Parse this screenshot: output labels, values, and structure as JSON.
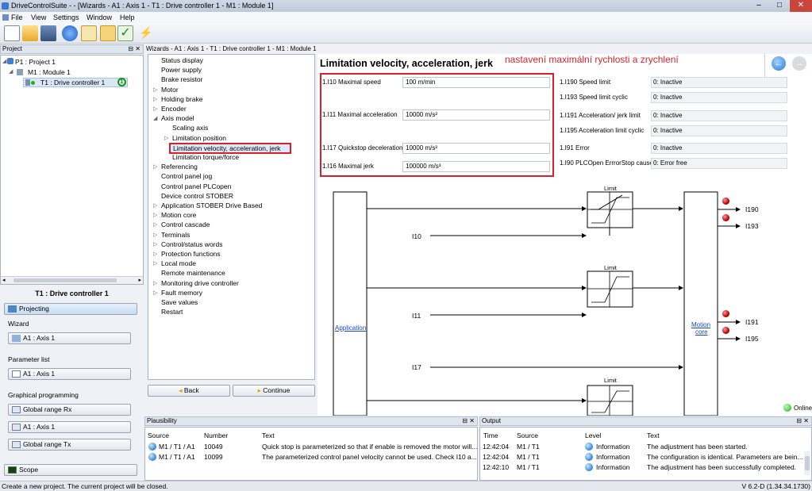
{
  "window": {
    "title": "DriveControlSuite - - [Wizards - A1 : Axis 1 - T1 : Drive controller 1 - M1 : Module 1]",
    "minimize": "–",
    "maximize": "□",
    "close": "✕"
  },
  "menu": [
    "File",
    "View",
    "Settings",
    "Window",
    "Help"
  ],
  "project_panel": {
    "title": "Project",
    "pin": "⊟ ✕",
    "tree": [
      "P1 : Project 1",
      "M1 : Module 1",
      "T1 : Drive controller 1"
    ]
  },
  "drive_panel": {
    "title": "T1 : Drive controller 1",
    "projecting": "Projecting",
    "wizard_label": "Wizard",
    "wizard_btn": "A1 : Axis 1",
    "param_label": "Parameter list",
    "param_btn": "A1 : Axis 1",
    "graph_label": "Graphical programming",
    "graph_btns": [
      "Global range Rx",
      "A1 : Axis 1",
      "Global range Tx"
    ],
    "scope": "Scope"
  },
  "wizard_breadcrumb": "Wizards - A1 : Axis 1 - T1 : Drive controller 1 - M1 : Module 1",
  "wizard_list": [
    "Status display",
    "Power supply",
    "Brake resistor",
    "Motor",
    "Holding brake",
    "Encoder",
    "Axis model",
    "Scaling axis",
    "Limitation position",
    "Limitation velocity, acceleration, jerk",
    "Limitation torque/force",
    "Referencing",
    "Control panel jog",
    "Control panel PLCopen",
    "Device control STOBER",
    "Application STOBER Drive Based",
    "Motion core",
    "Control cascade",
    "Terminals",
    "Control/status words",
    "Protection functions",
    "Local mode",
    "Remote maintenance",
    "Monitoring drive controller",
    "Fault memory",
    "Save values",
    "Restart"
  ],
  "back_btn": "Back",
  "continue_btn": "Continue",
  "content": {
    "heading": "Limitation velocity, acceleration, jerk",
    "annotation": "nastavení maximální rychlosti a zrychlení",
    "params": [
      {
        "label": "1.I10 Maximal speed",
        "value": "100 m/min"
      },
      {
        "label": "1.I11 Maximal acceleration",
        "value": "10000 m/s²"
      },
      {
        "label": "1.I17 Quickstop deceleration",
        "value": "10000 m/s²"
      },
      {
        "label": "1.I16 Maximal jerk",
        "value": "100000 m/s³"
      }
    ],
    "status": [
      {
        "label": "1.I190 Speed limit",
        "value": "0: Inactive"
      },
      {
        "label": "1.I193 Speed limit cyclic",
        "value": "0: Inactive"
      },
      {
        "label": "1.I191 Acceleration/ jerk limit",
        "value": "0: Inactive"
      },
      {
        "label": "1.I195 Acceleration limit cyclic",
        "value": "0: Inactive"
      },
      {
        "label": "1.I91 Error",
        "value": "0: Inactive"
      },
      {
        "label": "1.I90 PLCOpen ErrrorStop cause",
        "value": "0: Error free"
      }
    ],
    "diagram": {
      "application": "Application",
      "motion_core_1": "Motion",
      "motion_core_2": "core",
      "limit": "Limit",
      "inputs": [
        "I10",
        "I11",
        "I17"
      ],
      "outputs": [
        "I190",
        "I193",
        "I191",
        "I195"
      ]
    },
    "online": "Online"
  },
  "plausibility": {
    "title": "Plausibility",
    "columns": [
      "Source",
      "Number",
      "Text"
    ],
    "rows": [
      {
        "source": "M1 / T1 / A1",
        "number": "10049",
        "text": "Quick stop is parameterized so that if enable is removed the motor will..."
      },
      {
        "source": "M1 / T1 / A1",
        "number": "10099",
        "text": "The parameterized control panel velocity cannot be used. Check I10 a..."
      }
    ]
  },
  "output": {
    "title": "Output",
    "columns": [
      "Time",
      "Source",
      "Level",
      "Text"
    ],
    "rows": [
      {
        "time": "12:42:04",
        "source": "M1 / T1",
        "level": "Information",
        "text": "The adjustment has been started."
      },
      {
        "time": "12:42:04",
        "source": "M1 / T1",
        "level": "Information",
        "text": "The configuration is identical. Parameters are bein..."
      },
      {
        "time": "12:42:10",
        "source": "M1 / T1",
        "level": "Information",
        "text": "The adjustment has been successfully completed."
      }
    ]
  },
  "statusbar": {
    "left": "Create a new project. The current project will be closed.",
    "right": "V 6.2-D (1.34.34.1730)"
  }
}
